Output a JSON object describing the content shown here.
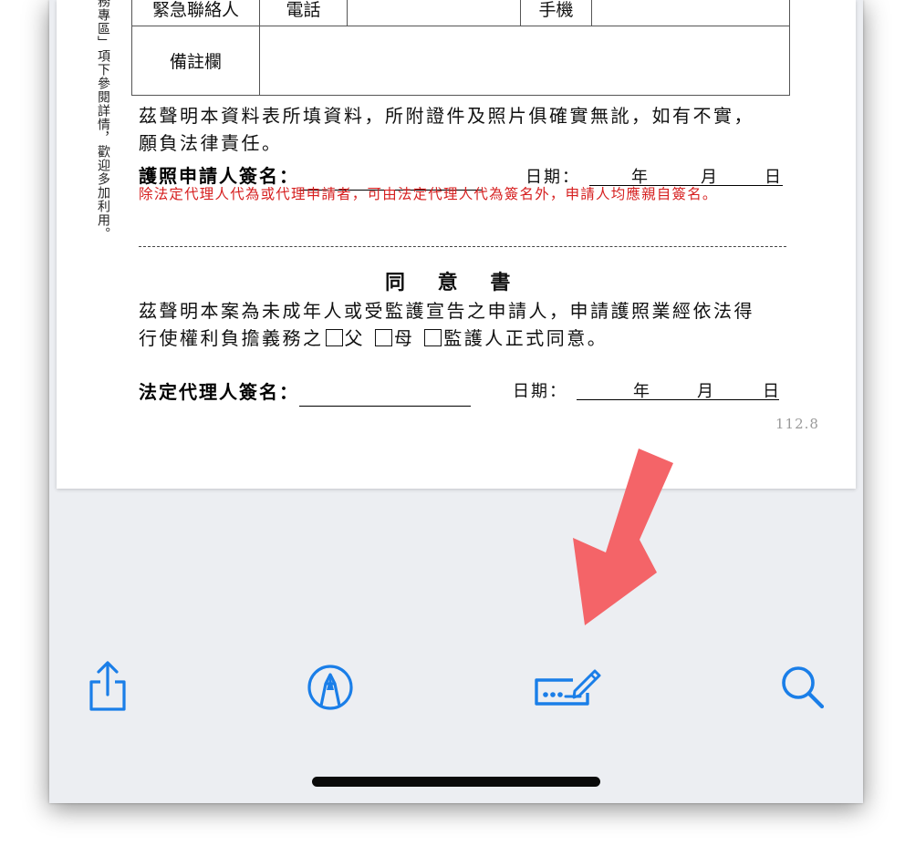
{
  "document": {
    "side_note": "務專區」項下參閱詳情，歡迎多加利用。",
    "table": {
      "contact_label": "緊急聯絡人",
      "phone_label": "電話",
      "mobile_label": "手機",
      "remark_label": "備註欄"
    },
    "declaration_line1": "茲聲明本資料表所填資料，所附證件及照片俱確實無訛，如有不實，",
    "declaration_line2": "願負法律責任。",
    "applicant_signature_label": "護照申請人簽名：",
    "date_label": "日期：",
    "year": "年",
    "month": "月",
    "day": "日",
    "red_note": "除法定代理人代為或代理申請者，可由法定代理人代為簽名外，申請人均應親自簽名。",
    "consent_title": "同 意 書",
    "consent_line1": "茲聲明本案為未成年人或受監護宣告之申請人，申請護照業經依法得",
    "consent_line2_prefix": "行使權利負擔義務之",
    "consent_father": "父",
    "consent_mother": "母",
    "consent_guardian": "監護人正式同意。",
    "guardian_signature_label": "法定代理人簽名：",
    "version": "112.8"
  },
  "toolbar": {
    "share_icon": "share-icon",
    "markup_icon": "markup-pen-icon",
    "fill_sign_icon": "fill-and-sign-icon",
    "search_icon": "search-icon",
    "accent_color": "#1a7ee8"
  },
  "annotation": {
    "arrow_color": "#f46468"
  }
}
